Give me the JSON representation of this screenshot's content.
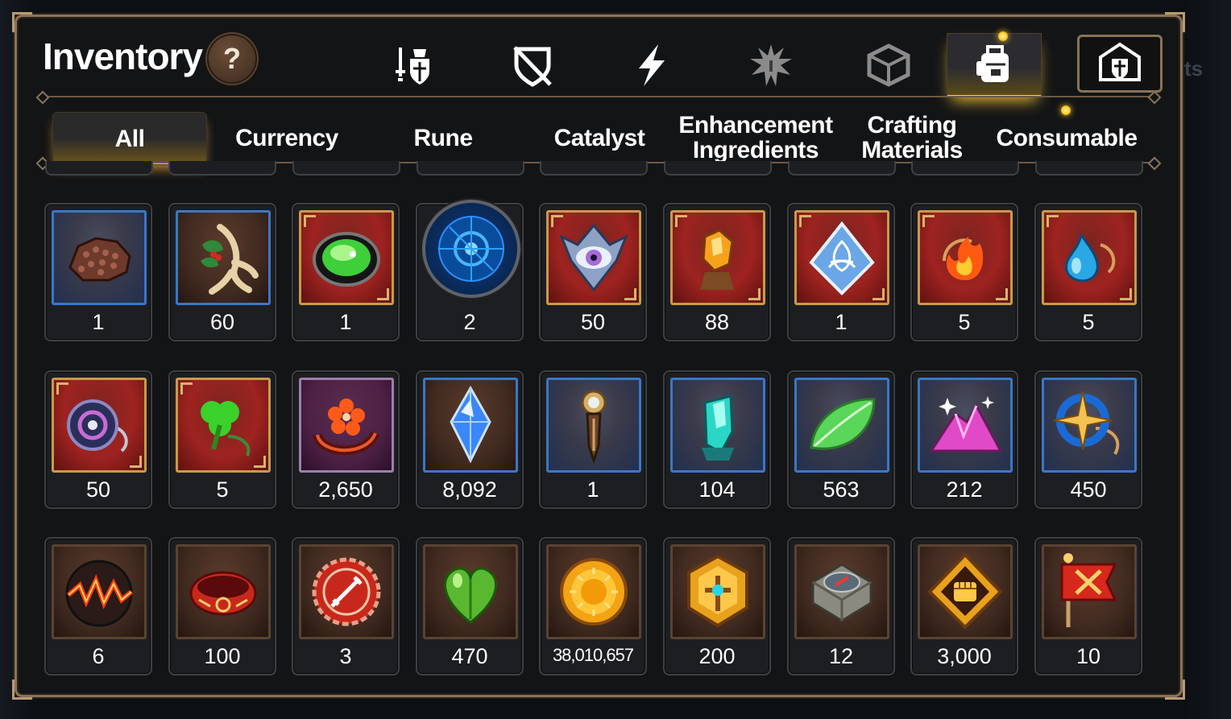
{
  "header": {
    "title": "Inventory",
    "help_label": "?"
  },
  "category_tabs": [
    {
      "name": "equipment-icon"
    },
    {
      "name": "broken-shield-icon"
    },
    {
      "name": "lightning-icon"
    },
    {
      "name": "splash-icon"
    },
    {
      "name": "rune-cube-icon"
    },
    {
      "name": "backpack-icon",
      "active": true,
      "notification": true
    },
    {
      "name": "guild-shield-icon"
    }
  ],
  "sub_tabs": [
    {
      "label": "All",
      "active": true
    },
    {
      "label": "Currency"
    },
    {
      "label": "Rune"
    },
    {
      "label": "Catalyst"
    },
    {
      "label": "Enhancement\nIngredients"
    },
    {
      "label": "Crafting\nMaterials"
    },
    {
      "label": "Consumable",
      "notification": true
    }
  ],
  "items": [
    {
      "icon": "ore-chunk-icon",
      "qty": "1"
    },
    {
      "icon": "ginseng-root-icon",
      "qty": "60"
    },
    {
      "icon": "green-gem-icon",
      "qty": "1"
    },
    {
      "icon": "blue-rune-orb-icon",
      "qty": "2"
    },
    {
      "icon": "eye-crest-icon",
      "qty": "50"
    },
    {
      "icon": "amber-crystal-icon",
      "qty": "88"
    },
    {
      "icon": "triquetra-crystal-icon",
      "qty": "1"
    },
    {
      "icon": "fire-pendant-icon",
      "qty": "5"
    },
    {
      "icon": "water-pendant-icon",
      "qty": "5"
    },
    {
      "icon": "eye-pendant-icon",
      "qty": "50"
    },
    {
      "icon": "clover-pendant-icon",
      "qty": "5"
    },
    {
      "icon": "flower-ring-icon",
      "qty": "2,650"
    },
    {
      "icon": "blue-crystal-icon",
      "qty": "8,092"
    },
    {
      "icon": "compass-key-icon",
      "qty": "1"
    },
    {
      "icon": "teal-crystal-icon",
      "qty": "104"
    },
    {
      "icon": "green-leaf-icon",
      "qty": "563"
    },
    {
      "icon": "pink-ore-icon",
      "qty": "212"
    },
    {
      "icon": "star-pendant-icon",
      "qty": "450"
    },
    {
      "icon": "lava-orb-icon",
      "qty": "6"
    },
    {
      "icon": "rune-bracelet-icon",
      "qty": "100"
    },
    {
      "icon": "sword-badge-icon",
      "qty": "3"
    },
    {
      "icon": "green-heart-icon",
      "qty": "470"
    },
    {
      "icon": "gold-sun-coin-icon",
      "qty": "38,010,657"
    },
    {
      "icon": "gold-emblem-icon",
      "qty": "200"
    },
    {
      "icon": "stone-compass-icon",
      "qty": "12"
    },
    {
      "icon": "fist-badge-icon",
      "qty": "3,000"
    },
    {
      "icon": "war-banner-icon",
      "qty": "10"
    }
  ]
}
